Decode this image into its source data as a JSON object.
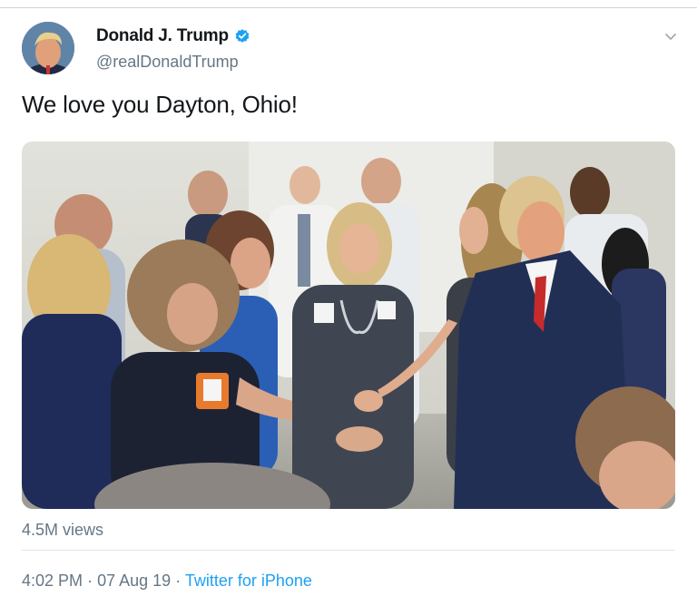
{
  "author": {
    "display_name": "Donald J. Trump",
    "handle": "@realDonaldTrump",
    "verified": true,
    "verified_color": "#1da1f2"
  },
  "tweet": {
    "text": "We love you Dayton, Ohio!",
    "views": "4.5M views",
    "time": "4:02 PM",
    "date": "07 Aug 19",
    "separator": "·",
    "source": "Twitter for iPhone"
  },
  "icons": {
    "more": "chevron-down-icon",
    "verified": "verified-badge-icon"
  },
  "colors": {
    "primary_text": "#14171a",
    "secondary_text": "#657786",
    "link": "#1da1f2"
  }
}
